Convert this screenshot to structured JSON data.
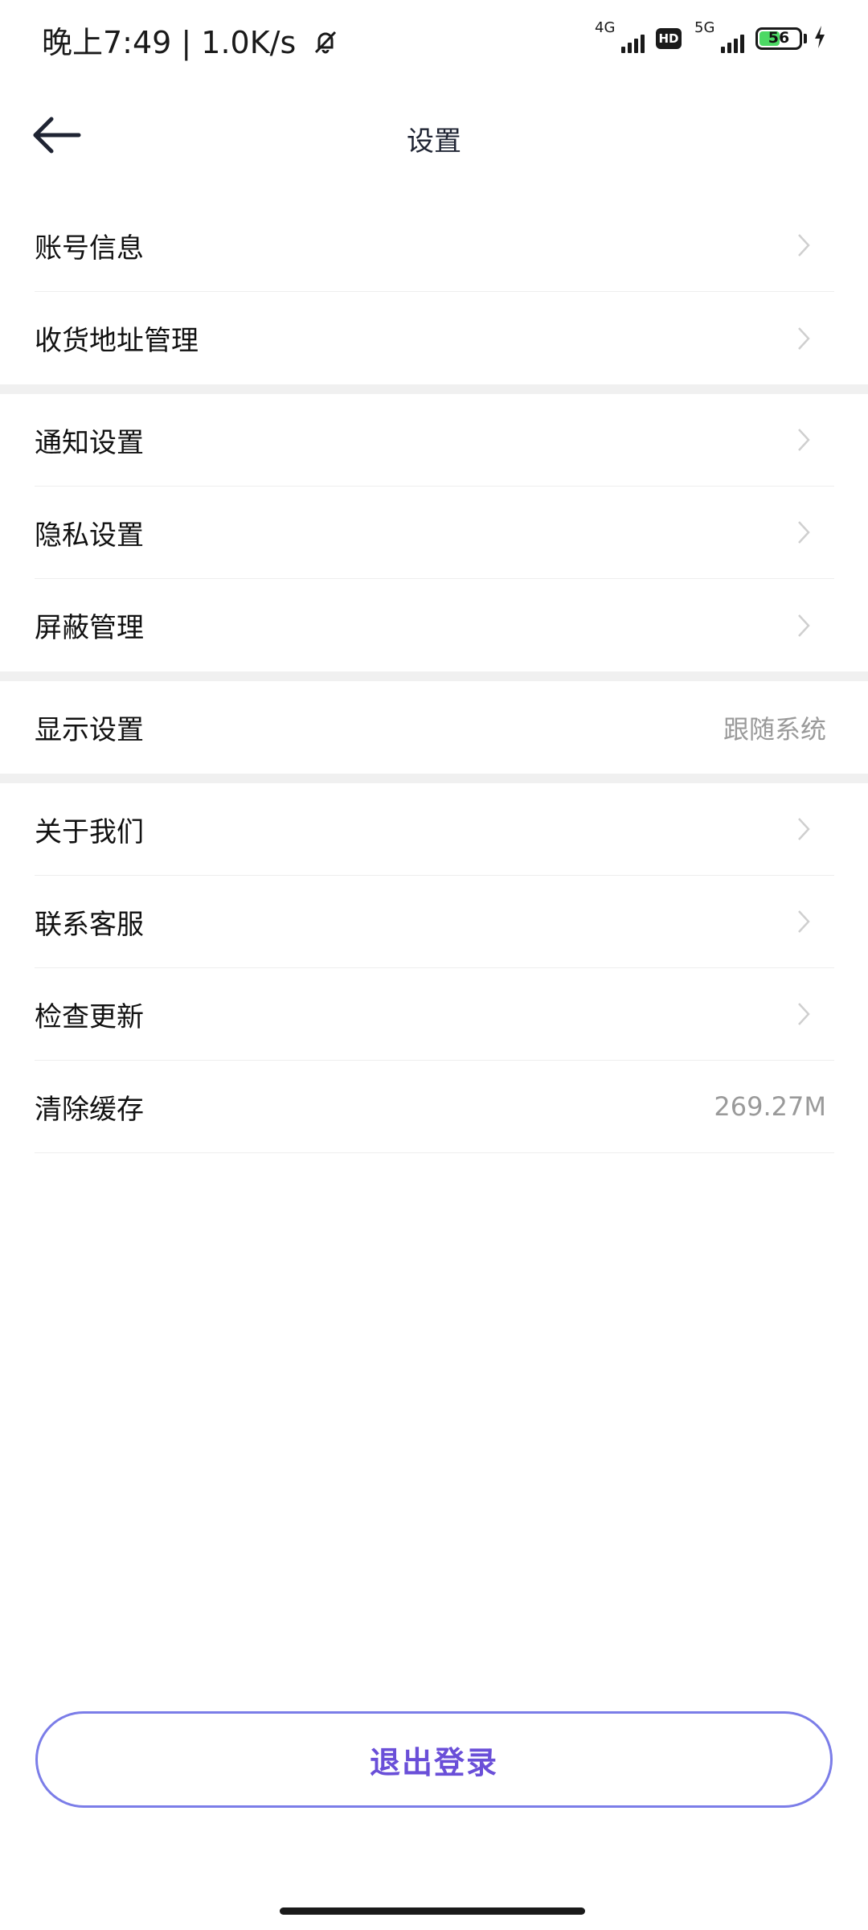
{
  "status_bar": {
    "time": "晚上7:49 | 1.0K/s",
    "network1": "4G",
    "hd_label": "HD",
    "network2": "5G",
    "battery_level": "56",
    "battery_fraction": 0.56,
    "icons": [
      "mute-bell-icon",
      "signal-icon",
      "hd-icon",
      "battery-icon",
      "charging-icon"
    ]
  },
  "nav": {
    "title": "设置",
    "back_icon": "back-arrow-icon"
  },
  "groups": [
    {
      "items": [
        {
          "label": "账号信息"
        },
        {
          "label": "收货地址管理"
        }
      ]
    },
    {
      "items": [
        {
          "label": "通知设置"
        },
        {
          "label": "隐私设置"
        },
        {
          "label": "屏蔽管理"
        }
      ]
    },
    {
      "items": [
        {
          "label": "显示设置",
          "value": "跟随系统"
        }
      ]
    },
    {
      "items": [
        {
          "label": "关于我们"
        },
        {
          "label": "联系客服"
        },
        {
          "label": "检查更新"
        },
        {
          "label": "清除缓存",
          "value": "269.27M"
        }
      ]
    }
  ],
  "logout": {
    "label": "退出登录"
  },
  "colors": {
    "accent": "#6a4fd8",
    "logout_border": "#7b7de8",
    "value_text": "#9a9a9a",
    "divider": "#f0f0f0"
  }
}
